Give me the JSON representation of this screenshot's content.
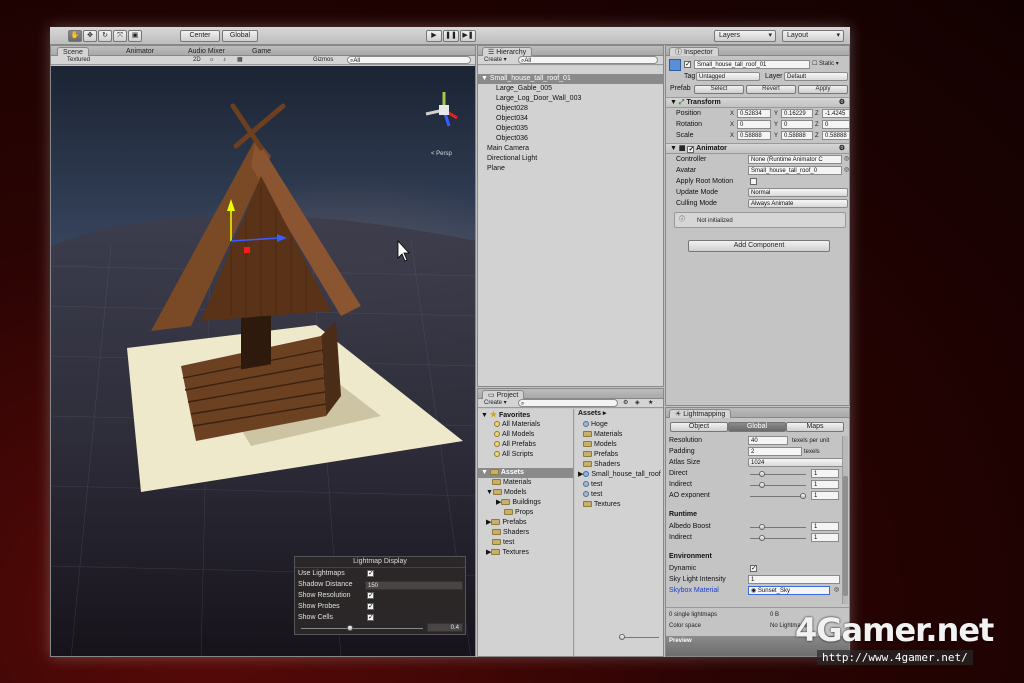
{
  "toolbar": {
    "pivot_label": "Center",
    "space_label": "Global",
    "layers_label": "Layers",
    "layout_label": "Layout"
  },
  "scene": {
    "tabs": [
      "Scene",
      "Animator",
      "Audio Mixer",
      "Game"
    ],
    "shading_mode": "Textured",
    "mode_2d": "2D",
    "gizmos_label": "Gizmos",
    "search_placeholder": "All",
    "persp_label": "Persp",
    "lightmap_display": {
      "title": "Lightmap Display",
      "rows": [
        {
          "label": "Use Lightmaps",
          "checked": "✓"
        },
        {
          "label": "Shadow Distance",
          "value": "150"
        },
        {
          "label": "Show Resolution",
          "checked": "✓"
        },
        {
          "label": "Show Probes",
          "checked": "✓"
        },
        {
          "label": "Show Cells",
          "checked": "✓"
        }
      ],
      "slider_value": "0.4"
    }
  },
  "hierarchy": {
    "tab": "Hierarchy",
    "create_label": "Create",
    "search_placeholder": "All",
    "items": [
      {
        "label": "Small_house_tall_roof_01",
        "indent": 0,
        "selected": true,
        "arrow": "▼"
      },
      {
        "label": "Large_Gable_005",
        "indent": 1
      },
      {
        "label": "Large_Log_Door_Wall_003",
        "indent": 1
      },
      {
        "label": "Object028",
        "indent": 1
      },
      {
        "label": "Object034",
        "indent": 1
      },
      {
        "label": "Object035",
        "indent": 1
      },
      {
        "label": "Object036",
        "indent": 1
      },
      {
        "label": "Main Camera",
        "indent": 0
      },
      {
        "label": "Directional Light",
        "indent": 0
      },
      {
        "label": "Plane",
        "indent": 0
      }
    ]
  },
  "inspector": {
    "tab": "Inspector",
    "object_name": "Small_house_tall_roof_01",
    "static_label": "Static",
    "tag_label": "Tag",
    "tag_value": "Untagged",
    "layer_label": "Layer",
    "layer_value": "Default",
    "prefab_label": "Prefab",
    "prefab_buttons": [
      "Select",
      "Revert",
      "Apply"
    ],
    "transform": {
      "title": "Transform",
      "rows": [
        {
          "label": "Position",
          "x": "0.52834",
          "y": "0.16229",
          "z": "-1.4245"
        },
        {
          "label": "Rotation",
          "x": "0",
          "y": "0",
          "z": "0"
        },
        {
          "label": "Scale",
          "x": "0.58888",
          "y": "0.58888",
          "z": "0.58888"
        }
      ]
    },
    "animator": {
      "title": "Animator",
      "rows": [
        {
          "label": "Controller",
          "value": "None (Runtime Animator C"
        },
        {
          "label": "Avatar",
          "value": "Small_house_tall_roof_0"
        },
        {
          "label": "Apply Root Motion",
          "value": ""
        },
        {
          "label": "Update Mode",
          "value": "Normal"
        },
        {
          "label": "Culling Mode",
          "value": "Always Animate"
        }
      ],
      "info": "Not initialized"
    },
    "add_component": "Add Component"
  },
  "project": {
    "tab": "Project",
    "create_label": "Create",
    "favorites_label": "Favorites",
    "favorites": [
      "All Materials",
      "All Models",
      "All Prefabs",
      "All Scripts"
    ],
    "assets_label": "Assets",
    "tree": [
      {
        "label": "Materials",
        "indent": 1
      },
      {
        "label": "Models",
        "indent": 1
      },
      {
        "label": "Buildings",
        "indent": 2
      },
      {
        "label": "Props",
        "indent": 2
      },
      {
        "label": "Prefabs",
        "indent": 1
      },
      {
        "label": "Shaders",
        "indent": 1
      },
      {
        "label": "test",
        "indent": 1
      },
      {
        "label": "Textures",
        "indent": 1
      }
    ],
    "breadcrumb": "Assets",
    "items": [
      "Hoge",
      "Materials",
      "Models",
      "Prefabs",
      "Shaders",
      "Small_house_tall_roof",
      "test",
      "test",
      "Textures"
    ]
  },
  "lightmapping": {
    "tab": "Lightmapping",
    "tabs": [
      "Object",
      "Global",
      "Maps"
    ],
    "rows": [
      {
        "label": "Resolution",
        "value": "40",
        "unit": "texels per unit"
      },
      {
        "label": "Padding",
        "value": "2",
        "unit": "texels"
      },
      {
        "label": "Atlas Size",
        "value": "1024"
      },
      {
        "label": "Direct",
        "value": "1"
      },
      {
        "label": "Indirect",
        "value": "1"
      },
      {
        "label": "AO exponent",
        "value": "1"
      }
    ],
    "runtime_label": "Runtime",
    "runtime_rows": [
      {
        "label": "Albedo Boost",
        "value": "1"
      },
      {
        "label": "Indirect",
        "value": "1"
      }
    ],
    "environment_label": "Environment",
    "dynamic_label": "Dynamic",
    "sky_intensity_label": "Sky Light Intensity",
    "sky_intensity_value": "1",
    "skybox_label": "Skybox Material",
    "skybox_value": "Sunset_Sky",
    "status_left": "0 single lightmaps",
    "status_right": "0 B",
    "color_space_label": "Color space",
    "color_space_value": "No Lightmaps",
    "preview_label": "Preview"
  },
  "watermark": {
    "logo": "4Gamer.net",
    "url": "http://www.4gamer.net/"
  }
}
